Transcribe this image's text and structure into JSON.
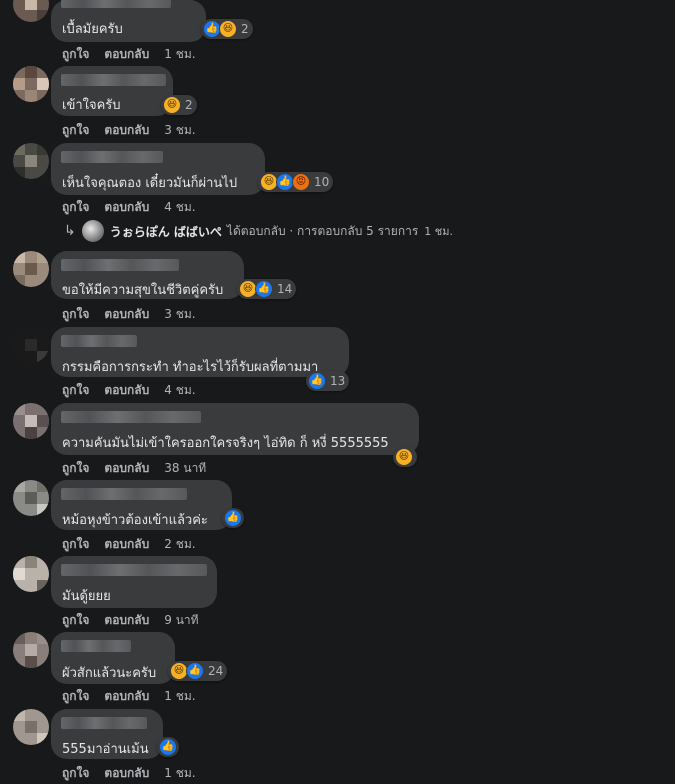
{
  "actions": {
    "like": "ถูกใจ",
    "reply": "ตอบกลับ"
  },
  "comments": [
    {
      "text": "เบื้ลมัยครับ",
      "reactions": [
        "like",
        "haha"
      ],
      "count": "2",
      "time": "1 ชม."
    },
    {
      "text": "เข้าใจครับ",
      "reactions": [
        "haha"
      ],
      "count": "2",
      "time": "3 ชม."
    },
    {
      "text": "เห็นใจคุณตอง เดี๋ยวมันก็ผ่านไป",
      "reactions": [
        "haha",
        "like",
        "angry"
      ],
      "count": "10",
      "time": "4 ชม."
    },
    {
      "text": "ขอให้มีความสุขในชีวิตคู่ครับ",
      "reactions": [
        "haha",
        "like"
      ],
      "count": "14",
      "time": "3 ชม."
    },
    {
      "text": "กรรมคือการกระทำ ทำอะไรไว้ก็รับผลที่ตามมา",
      "reactions": [
        "like"
      ],
      "count": "13",
      "time": "4 ชม."
    },
    {
      "text": "ความคันมันไม่เข้าใครออกใครจริงๆ ไอ่ทิด ก็ หงี่ 5555555",
      "reactions": [
        "haha"
      ],
      "count": "",
      "time": "38 นาที"
    },
    {
      "text": "หม้อหุงข้าวต้องเข้าแล้วค่ะ",
      "reactions": [
        "like"
      ],
      "count": "",
      "time": "2 ชม."
    },
    {
      "text": "มันดู้ยยย",
      "reactions": [],
      "count": "",
      "time": "9 นาที"
    },
    {
      "text": "ผัวสักแล้วนะครับ",
      "reactions": [
        "haha",
        "like"
      ],
      "count": "24",
      "time": "1 ชม."
    },
    {
      "text": "555มาอ่านเม้น",
      "reactions": [
        "like"
      ],
      "count": "",
      "time": "1 ชม."
    }
  ],
  "reply_summary": {
    "name": "うぉらぽん ばばいぺ",
    "text": "ได้ตอบกลับ · การตอบกลับ 5 รายการ",
    "time": "1 ชม."
  },
  "colors": {
    "background": "#18191a",
    "bubble": "#3a3b3c",
    "like": "#1877f2",
    "haha": "#f7b125",
    "angry": "#e9710f"
  }
}
